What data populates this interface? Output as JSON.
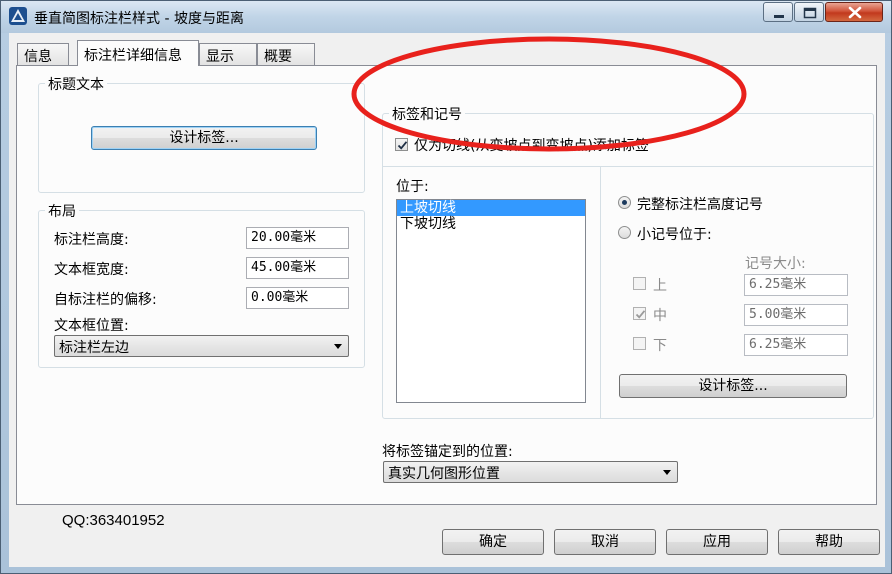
{
  "window": {
    "title": "垂直简图标注栏样式 - 坡度与距离"
  },
  "tabs": [
    {
      "label": "信息"
    },
    {
      "label": "标注栏详细信息"
    },
    {
      "label": "显示"
    },
    {
      "label": "概要"
    }
  ],
  "title_text_group": {
    "title": "标题文本",
    "design_button": "设计标签..."
  },
  "layout_group": {
    "title": "布局",
    "height_label": "标注栏高度:",
    "height_value": "20.00毫米",
    "width_label": "文本框宽度:",
    "width_value": "45.00毫米",
    "offset_label": "自标注栏的偏移:",
    "offset_value": "0.00毫米",
    "position_label": "文本框位置:",
    "position_value": "标注栏左边"
  },
  "labels_group": {
    "title": "标签和记号",
    "only_tangent_checkbox": "仅为切线(从变坡点到变坡点)添加标签",
    "located_label": "位于:",
    "list_items": [
      "上坡切线",
      "下坡切线"
    ],
    "full_tick_radio": "完整标注栏高度记号",
    "small_tick_radio": "小记号位于:",
    "tick_size_label": "记号大小:",
    "tick_rows": [
      {
        "label": "上",
        "value": "6.25毫米",
        "checked": false
      },
      {
        "label": "中",
        "value": "5.00毫米",
        "checked": true
      },
      {
        "label": "下",
        "value": "6.25毫米",
        "checked": false
      }
    ],
    "design_button": "设计标签..."
  },
  "anchor": {
    "label": "将标签锚定到的位置:",
    "value": "真实几何图形位置"
  },
  "qq_text": "QQ:363401952",
  "footer": {
    "ok": "确定",
    "cancel": "取消",
    "apply": "应用",
    "help": "帮助"
  },
  "colors": {
    "annotation_ellipse": "#e8211c",
    "selection": "#3399ff"
  }
}
